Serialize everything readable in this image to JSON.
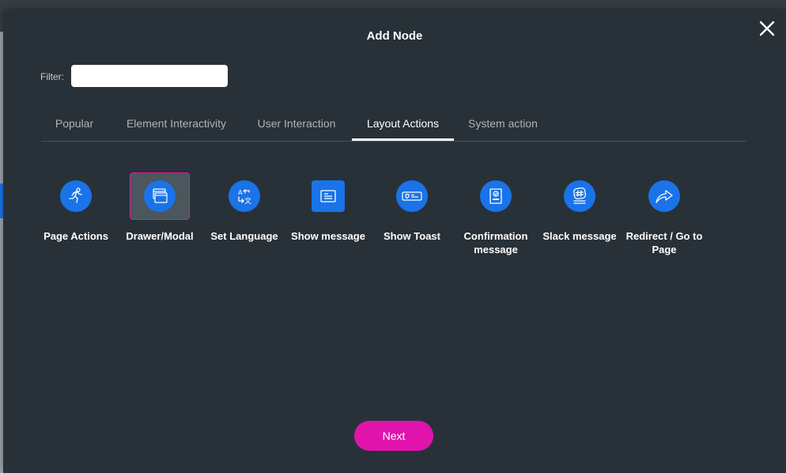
{
  "dialog": {
    "title": "Add Node",
    "close_icon": "close-icon"
  },
  "filter": {
    "label": "Filter:",
    "value": "",
    "placeholder": ""
  },
  "tabs": [
    {
      "label": "Popular",
      "active": false
    },
    {
      "label": "Element Interactivity",
      "active": false
    },
    {
      "label": "User Interaction",
      "active": false
    },
    {
      "label": "Layout Actions",
      "active": true
    },
    {
      "label": "System action",
      "active": false
    }
  ],
  "nodes": [
    {
      "label": "Page Actions",
      "icon": "running-person-icon",
      "selected": false
    },
    {
      "label": "Drawer/Modal",
      "icon": "stacked-windows-icon",
      "selected": true
    },
    {
      "label": "Set Language",
      "icon": "translate-icon",
      "selected": false
    },
    {
      "label": "Show message",
      "icon": "message-box-icon",
      "selected": false
    },
    {
      "label": "Show Toast",
      "icon": "toast-card-icon",
      "selected": false
    },
    {
      "label": "Confirmation message",
      "icon": "confirmation-icon",
      "selected": false
    },
    {
      "label": "Slack message",
      "icon": "slack-hash-icon",
      "selected": false
    },
    {
      "label": "Redirect / Go to Page",
      "icon": "redirect-arrow-icon",
      "selected": false
    }
  ],
  "footer": {
    "next_label": "Next"
  },
  "colors": {
    "accent": "#e014ad",
    "icon_blue": "#1a73e8",
    "modal_bg": "#283138"
  }
}
